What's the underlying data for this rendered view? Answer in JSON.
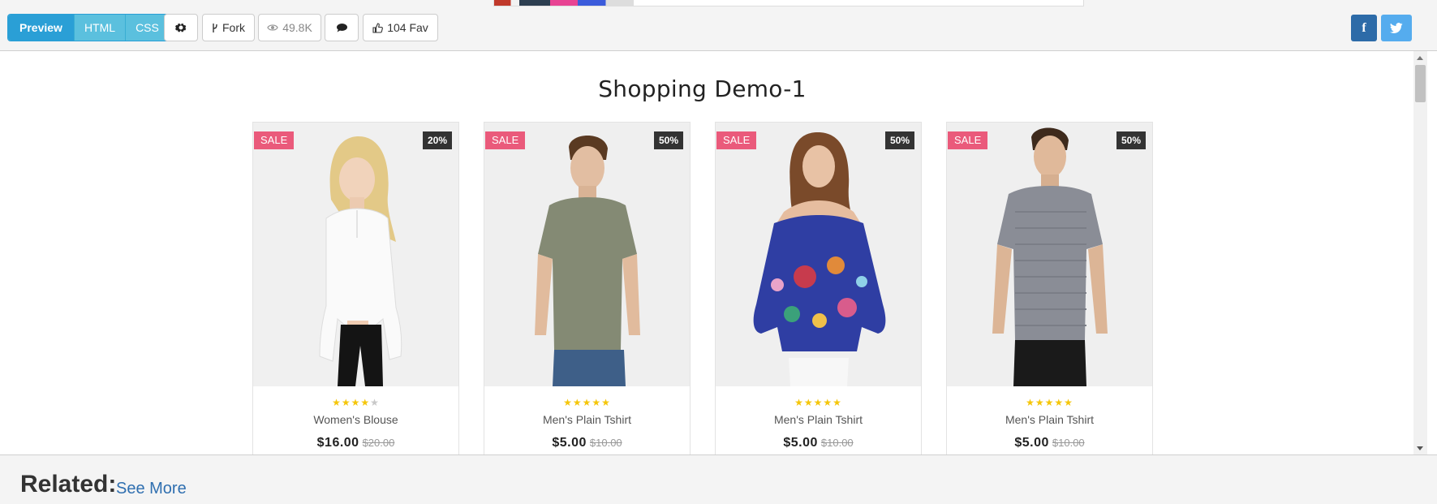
{
  "toolbar": {
    "tabs": [
      {
        "label": "Preview"
      },
      {
        "label": "HTML"
      },
      {
        "label": "CSS"
      }
    ],
    "fork_label": "Fork",
    "views_label": "49.8K",
    "fav_label": "104 Fav"
  },
  "social": {
    "facebook": "f"
  },
  "page": {
    "title": "Shopping Demo-1",
    "products": [
      {
        "sale": "SALE",
        "discount": "20%",
        "rating": 4,
        "name": "Women's Blouse",
        "price": "$16.00",
        "old_price": "$20.00"
      },
      {
        "sale": "SALE",
        "discount": "50%",
        "rating": 5,
        "name": "Men's Plain Tshirt",
        "price": "$5.00",
        "old_price": "$10.00"
      },
      {
        "sale": "SALE",
        "discount": "50%",
        "rating": 5,
        "name": "Men's Plain Tshirt",
        "price": "$5.00",
        "old_price": "$10.00"
      },
      {
        "sale": "SALE",
        "discount": "50%",
        "rating": 5,
        "name": "Men's Plain Tshirt",
        "price": "$5.00",
        "old_price": "$10.00"
      }
    ]
  },
  "related": {
    "heading": "Related:",
    "link": "See More"
  },
  "colors": {
    "sale_badge": "#ea5a7b",
    "star": "#f5c60a",
    "accent": "#2a9fd6"
  }
}
